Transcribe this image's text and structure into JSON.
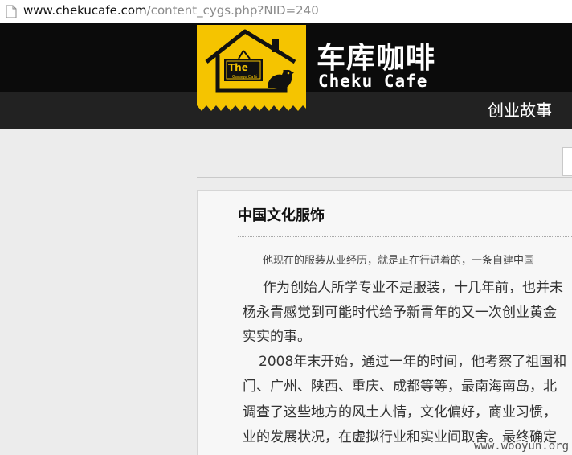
{
  "browser": {
    "url_host": "www.chekucafe.com",
    "url_path": "/content_cygs.php?NID=240"
  },
  "header": {
    "logo_small": "The",
    "logo_tiny": "Garage Café",
    "brand_cn": "车库咖啡",
    "brand_en": "Cheku Cafe",
    "nav_item": "创业故事"
  },
  "article": {
    "title": "中国文化服饰",
    "intro": "他现在的服装从业经历，就是正在行进着的，一条自建中国",
    "lines": [
      "作为创始人所学专业不是服装，十几年前，也并未",
      "杨永青感觉到可能时代给予新青年的又一次创业黄金",
      "实实的事。",
      "2008年末开始，通过一年的时间，他考察了祖国和",
      "门、广州、陕西、重庆、成都等等，最南海南岛，北",
      "调查了这些地方的风土人情，文化偏好，商业习惯，",
      "业的发展状况，在虚拟行业和实业间取舍。最终确定"
    ]
  },
  "watermark": "www.wooyun.org",
  "colors": {
    "logo_yellow": "#f5c400",
    "header_black": "#0b0b0b",
    "nav_dark": "#222222"
  }
}
